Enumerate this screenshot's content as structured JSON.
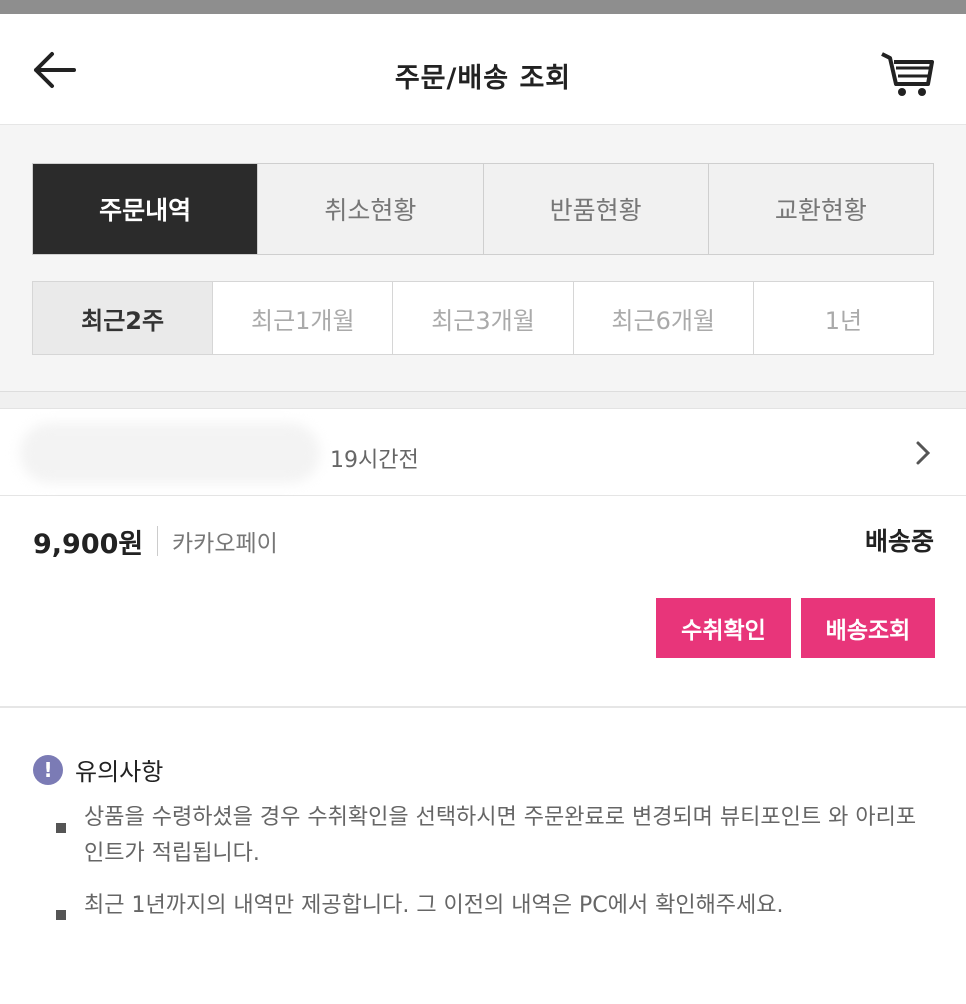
{
  "header": {
    "title": "주문/배송 조회",
    "back_icon": "arrow-left-icon",
    "cart_icon": "cart-icon"
  },
  "tabs": [
    {
      "label": "주문내역",
      "active": true
    },
    {
      "label": "취소현황",
      "active": false
    },
    {
      "label": "반품현황",
      "active": false
    },
    {
      "label": "교환현황",
      "active": false
    }
  ],
  "periods": [
    {
      "label": "최근2주",
      "active": true
    },
    {
      "label": "최근1개월",
      "active": false
    },
    {
      "label": "최근3개월",
      "active": false
    },
    {
      "label": "최근6개월",
      "active": false
    },
    {
      "label": "1년",
      "active": false
    }
  ],
  "order": {
    "time": "19시간전",
    "price": "9,900원",
    "payment": "카카오페이",
    "status": "배송중",
    "confirm_button": "수취확인",
    "tracking_button": "배송조회"
  },
  "notice": {
    "title": "유의사항",
    "items": [
      "상품을 수령하셨을 경우 수취확인을 선택하시면 주문완료로 변경되며 뷰티포인트 와 아리포인트가 적립됩니다.",
      "최근 1년까지의 내역만 제공합니다. 그 이전의 내역은 PC에서 확인해주세요."
    ]
  },
  "colors": {
    "accent": "#e8357a",
    "active_tab": "#2b2b2b",
    "notice_icon": "#7b7bb5"
  }
}
